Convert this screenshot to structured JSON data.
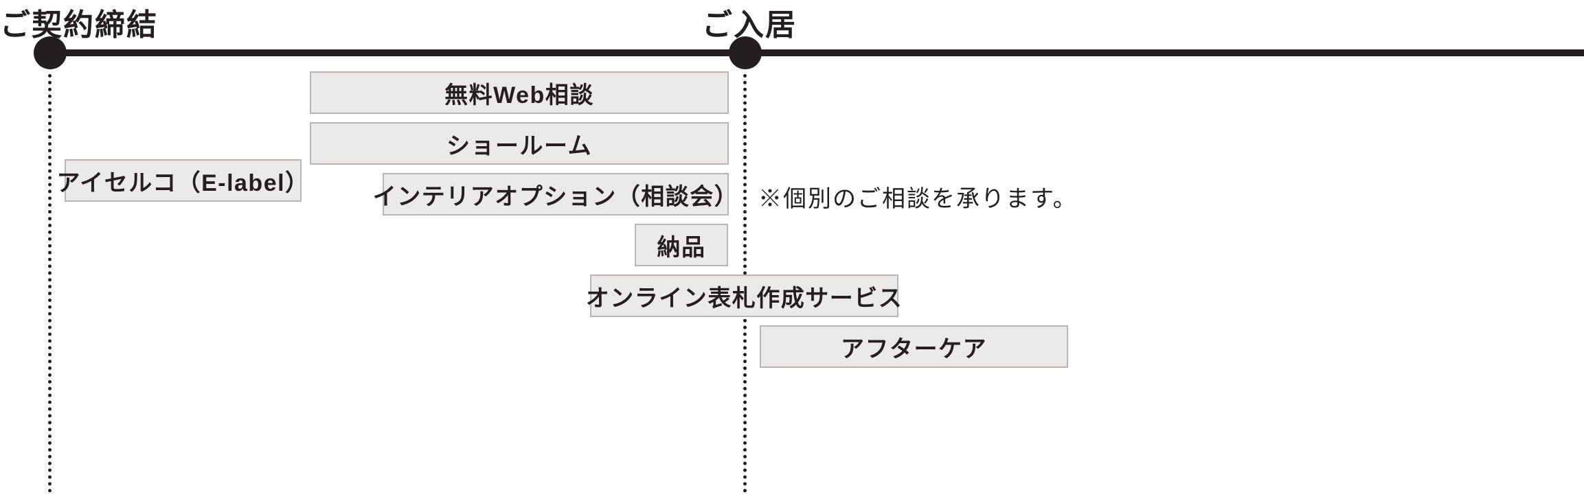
{
  "milestones": {
    "contract": "ご契約締結",
    "movein": "ご入居"
  },
  "boxes": {
    "aiserco": "アイセルコ（E-label）",
    "web_consult": "無料Web相談",
    "showroom": "ショールーム",
    "interior_option": "インテリアオプション（相談会）",
    "delivery": "納品",
    "nameplate": "オンライン表札作成サービス",
    "aftercare": "アフターケア"
  },
  "note": "※個別のご相談を承ります。"
}
